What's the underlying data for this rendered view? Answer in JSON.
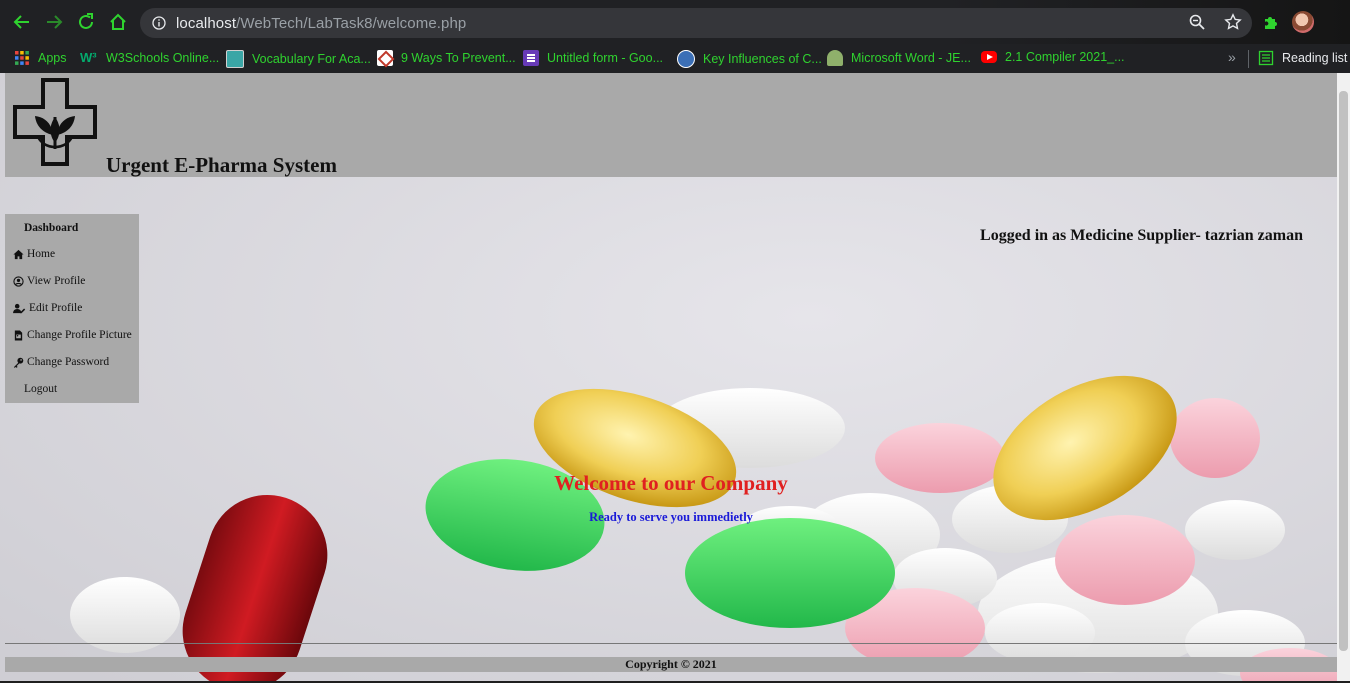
{
  "browser": {
    "url_host": "localhost",
    "url_path": "/WebTech/LabTask8/welcome.php",
    "bookmarks": [
      {
        "label": "Apps",
        "icon": "apps-grid-icon",
        "color": "#e8453c"
      },
      {
        "label": "W3Schools Online...",
        "icon": "w3schools-icon",
        "color": "#04aa6d"
      },
      {
        "label": "Vocabulary For Aca...",
        "icon": "vocabulary-site-icon",
        "color": "#3aa6a6"
      },
      {
        "label": "9 Ways To Prevent...",
        "icon": "prevent-site-icon",
        "color": "#ffffff"
      },
      {
        "label": "Untitled form - Goo...",
        "icon": "google-forms-icon",
        "color": "#673ab7"
      },
      {
        "label": "Key Influences of C...",
        "icon": "key-influences-icon",
        "color": "#3b6fb6"
      },
      {
        "label": "Microsoft Word - JE...",
        "icon": "word-doc-icon",
        "color": "#8fb06b"
      },
      {
        "label": "2.1 Compiler 2021_...",
        "icon": "youtube-icon",
        "color": "#ff0000"
      }
    ],
    "reading_list": "Reading list"
  },
  "header": {
    "title": "Urgent E-Pharma System"
  },
  "sidebar": {
    "title": "Dashboard",
    "items": [
      {
        "label": "Home",
        "icon": "home-icon"
      },
      {
        "label": "View Profile",
        "icon": "user-circle-icon"
      },
      {
        "label": "Edit Profile",
        "icon": "user-edit-icon"
      },
      {
        "label": "Change Profile Picture",
        "icon": "file-image-icon"
      },
      {
        "label": "Change Password",
        "icon": "key-icon"
      },
      {
        "label": "Logout",
        "icon": ""
      }
    ]
  },
  "status": {
    "logged_in": "Logged in as Medicine Supplier- tazrian zaman"
  },
  "main": {
    "welcome": "Welcome to our Company",
    "tagline": "Ready to serve you immedietly"
  },
  "footer": {
    "copyright": "Copyright © 2021"
  }
}
